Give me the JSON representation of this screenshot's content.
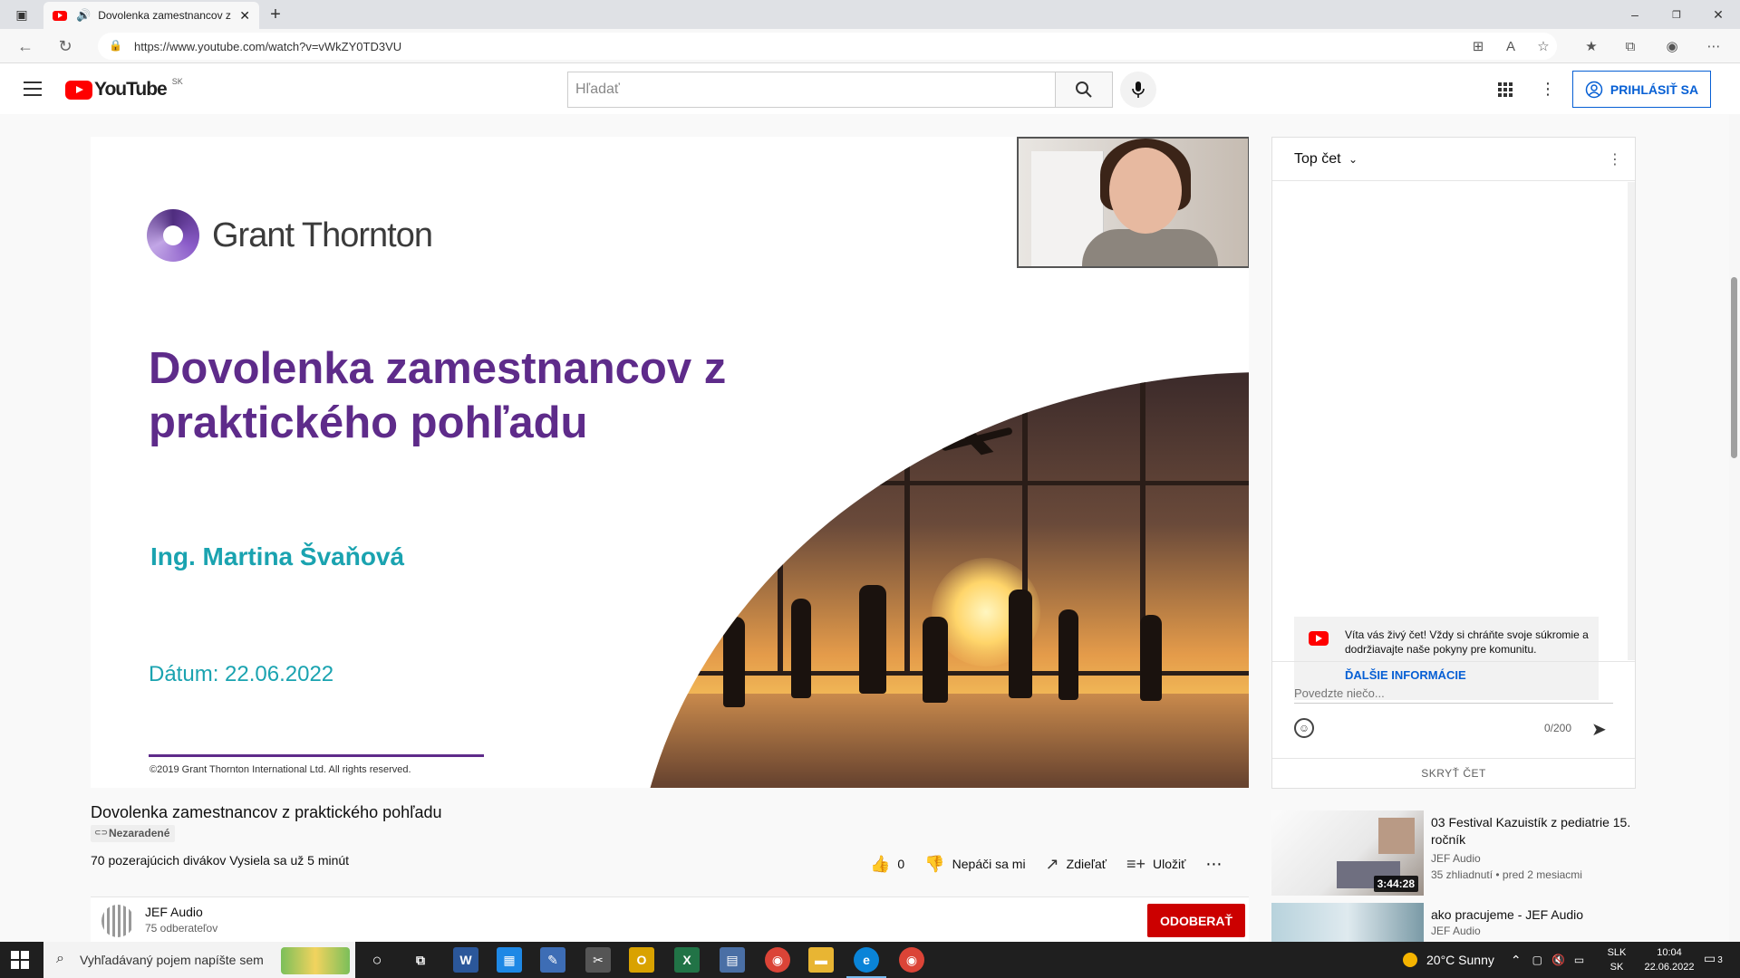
{
  "browser": {
    "tab_title": "Dovolenka zamestnancov z",
    "url": "https://www.youtube.com/watch?v=vWkZY0TD3VU"
  },
  "header": {
    "logo_text": "YouTube",
    "region": "SK",
    "search_placeholder": "Hľadať",
    "signin_label": "PRIHLÁSIŤ SA"
  },
  "slide": {
    "brand": "Grant Thornton",
    "title": "Dovolenka zamestnancov z praktického pohľadu",
    "presenter": "Ing. Martina Švaňová",
    "date": "Dátum: 22.06.2022",
    "copyright": "©2019 Grant Thornton International Ltd. All rights reserved."
  },
  "video": {
    "title": "Dovolenka zamestnancov z praktického pohľadu",
    "category": "Nezaradené",
    "viewers": "70 pozerajúcich divákov  Vysiela sa už 5 minút",
    "likes": "0",
    "dislike_label": "Nepáči sa mi",
    "share_label": "Zdieľať",
    "save_label": "Uložiť"
  },
  "channel": {
    "name": "JEF Audio",
    "subscribers": "75 odberateľov",
    "subscribe_label": "ODOBERAŤ"
  },
  "chat": {
    "title": "Top čet",
    "welcome": "Víta vás živý čet! Vždy si chráňte svoje súkromie a dodržiavajte naše pokyny pre komunitu.",
    "more_info": "ĎALŠIE INFORMÁCIE",
    "input_placeholder": "Povedzte niečo...",
    "counter": "0/200",
    "hide_label": "SKRYŤ ČET"
  },
  "recommendations": [
    {
      "title": "03 Festival Kazuistík z pediatrie 15. ročník",
      "channel": "JEF Audio",
      "meta": "35 zhliadnutí • pred 2 mesiacmi",
      "duration": "3:44:28"
    },
    {
      "title": "ako pracujeme - JEF Audio",
      "channel": "JEF Audio",
      "meta": "",
      "duration": ""
    }
  ],
  "taskbar": {
    "search_placeholder": "Vyhľadávaný pojem napíšte sem",
    "weather": "20°C  Sunny",
    "lang_top": "SLK",
    "lang_bottom": "SK",
    "time": "10:04",
    "date": "22.06.2022",
    "notifications": "3"
  },
  "colors": {
    "yt_red": "#ff0000",
    "link_blue": "#065fd4",
    "gt_purple": "#5e2b8a",
    "gt_teal": "#1aa3b0",
    "subscribe_red": "#cc0000"
  }
}
